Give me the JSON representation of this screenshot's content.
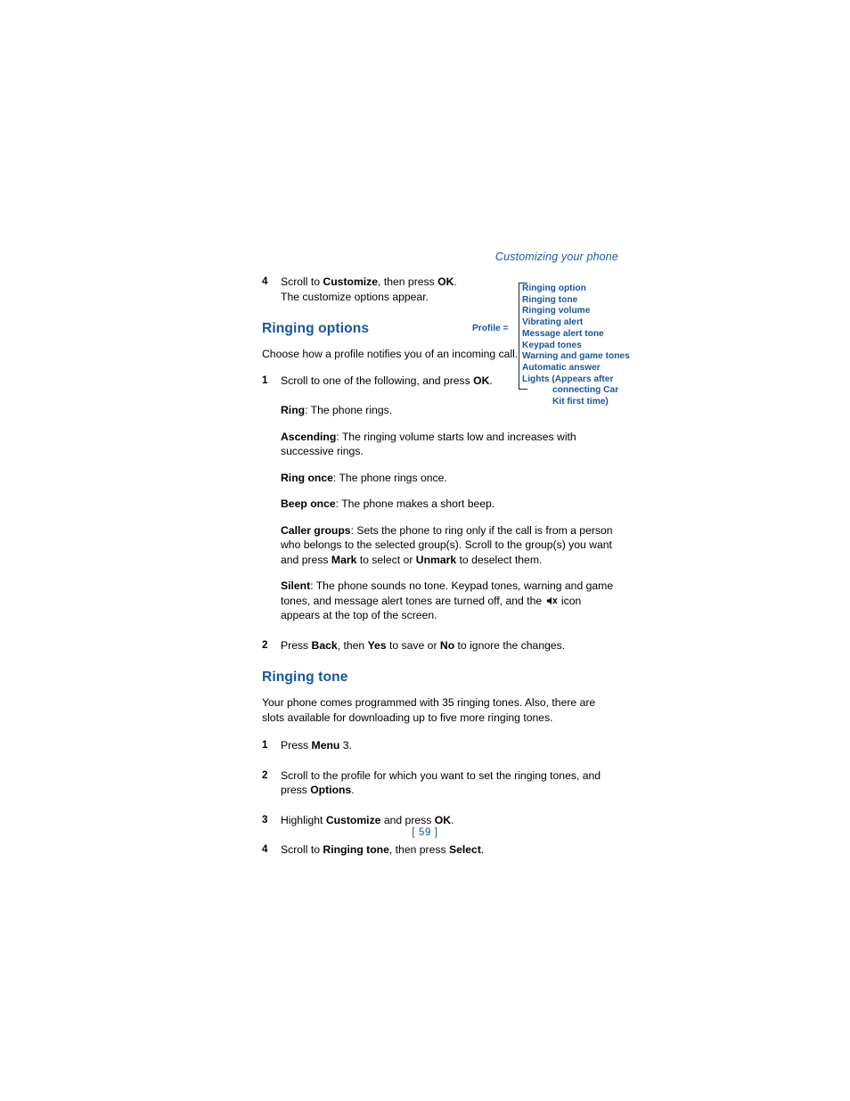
{
  "document": {
    "running_head": "Customizing your phone",
    "page_number": "[ 59 ]"
  },
  "content": {
    "step4_top": {
      "num": "4",
      "line1_pre": "Scroll to ",
      "line1_bold1": "Customize",
      "line1_mid": ", then press ",
      "line1_bold2": "OK",
      "line1_post": ".",
      "line2": "The customize options appear."
    },
    "ringing_options": {
      "heading": "Ringing options",
      "intro": "Choose how a profile notifies you of an incoming call.",
      "step1": {
        "num": "1",
        "text_pre": "Scroll to one of the following, and press ",
        "bold": "OK",
        "text_post": "."
      },
      "definitions": [
        {
          "term": "Ring",
          "text": ": The phone rings."
        },
        {
          "term": "Ascending",
          "text": ": The ringing volume starts low and increases with successive rings."
        },
        {
          "term": "Ring once",
          "text": ": The phone rings once."
        },
        {
          "term": "Beep once",
          "text": ": The phone makes a short beep."
        }
      ],
      "caller_groups": {
        "term": "Caller groups",
        "part1": ": Sets the phone to ring only if the call is from a person who belongs to the selected group(s). Scroll to the group(s) you want and press ",
        "bold1": "Mark",
        "part2": " to select or ",
        "bold2": "Unmark",
        "part3": " to deselect them."
      },
      "silent": {
        "term": "Silent",
        "part1": ": The phone sounds no tone. Keypad tones, warning and game tones, and message alert tones are turned off, and the ",
        "icon_name": "silent-mute-icon",
        "part2": " icon appears at the top of the screen."
      },
      "step2": {
        "num": "2",
        "pre": "Press ",
        "bold1": "Back",
        "mid1": ", then ",
        "bold2": "Yes",
        "mid2": " to save or ",
        "bold3": "No",
        "post": " to ignore the changes."
      }
    },
    "ringing_tone": {
      "heading": "Ringing tone",
      "intro": "Your phone comes programmed with 35 ringing tones. Also, there are slots available for downloading up to five more ringing tones.",
      "steps": [
        {
          "num": "1",
          "pre": "Press ",
          "bold1": "Menu",
          "post": " 3."
        },
        {
          "num": "2",
          "pre": "Scroll to the profile for which you want to set the ringing tones, and press ",
          "bold1": "Options",
          "post": "."
        },
        {
          "num": "3",
          "pre": "Highlight ",
          "bold1": "Customize",
          "mid": " and press ",
          "bold2": "OK",
          "post": "."
        },
        {
          "num": "4",
          "pre": "Scroll to ",
          "bold1": "Ringing tone",
          "mid": ", then press ",
          "bold2": "Select",
          "post": "."
        }
      ]
    }
  },
  "diagram": {
    "label": "Profile =",
    "items": [
      "Ringing option",
      "Ringing tone",
      "Ringing volume",
      "Vibrating alert",
      "Message alert tone",
      "Keypad tones",
      "Warning and game tones",
      "Automatic answer",
      "Lights (Appears after"
    ],
    "continuation": [
      "connecting Car",
      "Kit first time)"
    ]
  },
  "colors": {
    "heading_blue": "#19559e",
    "accent_blue": "#1e5aa8",
    "bracket": "#142a4e",
    "body_text": "#000000"
  }
}
